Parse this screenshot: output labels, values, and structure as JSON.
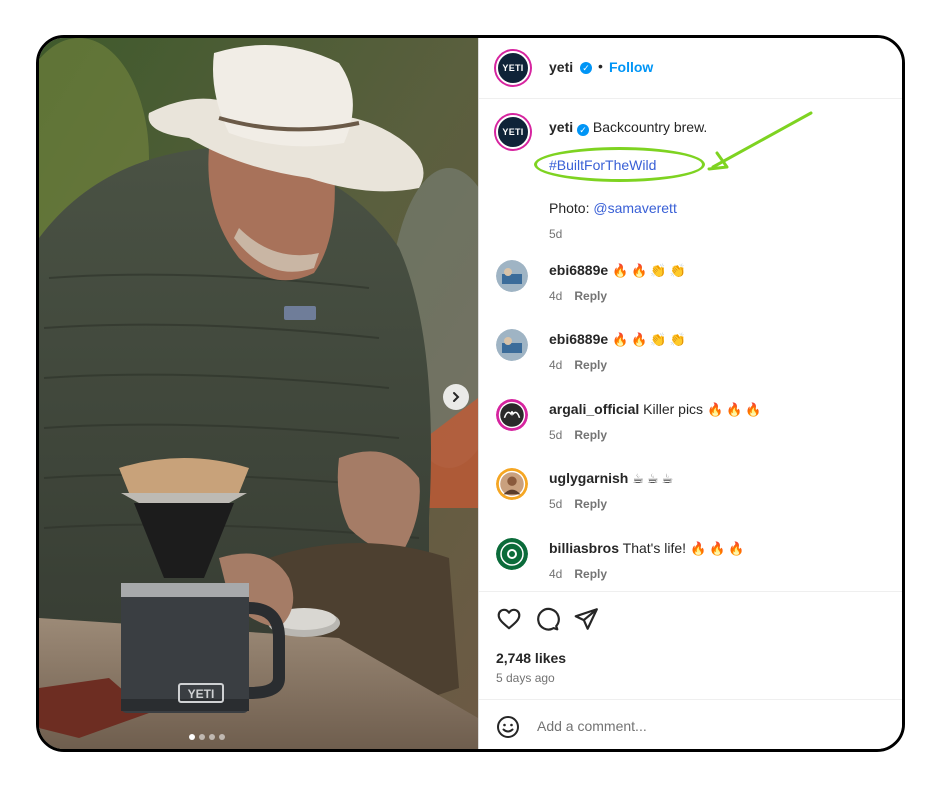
{
  "header": {
    "username": "yeti",
    "separator": "•",
    "follow_label": "Follow",
    "avatar_logo": "YETI"
  },
  "caption": {
    "username": "yeti",
    "text": "Backcountry brew.",
    "hashtag": "#BuiltForTheWild",
    "photo_label": "Photo:",
    "photo_credit": "@samaverett",
    "time": "5d"
  },
  "comments": [
    {
      "username": "ebi6889e",
      "text": "",
      "emojis": "🔥🔥👏👏",
      "time": "4d",
      "reply_label": "Reply"
    },
    {
      "username": "ebi6889e",
      "text": "",
      "emojis": "🔥🔥👏👏",
      "time": "4d",
      "reply_label": "Reply"
    },
    {
      "username": "argali_official",
      "text": "Killer pics",
      "emojis": "🔥🔥🔥",
      "time": "5d",
      "reply_label": "Reply"
    },
    {
      "username": "uglygarnish",
      "text": "",
      "emojis": "☕☕☕",
      "time": "5d",
      "reply_label": "Reply"
    },
    {
      "username": "billiasbros",
      "text": "That's life!",
      "emojis": "🔥🔥🔥",
      "time": "4d",
      "reply_label": "Reply"
    }
  ],
  "stats": {
    "likes": "2,748 likes",
    "posted": "5 days ago"
  },
  "add_comment": {
    "placeholder": "Add a comment..."
  },
  "icons": {
    "like": "heart-icon",
    "comment": "comment-icon",
    "share": "send-icon",
    "emoji": "smiley-icon",
    "next": "chevron-right-icon"
  },
  "colors": {
    "link": "#0095f6",
    "hashtag": "#385fd6",
    "annotation": "#7ed321",
    "verified": "#0095f6"
  },
  "photo": {
    "mug_brand": "YETI"
  }
}
